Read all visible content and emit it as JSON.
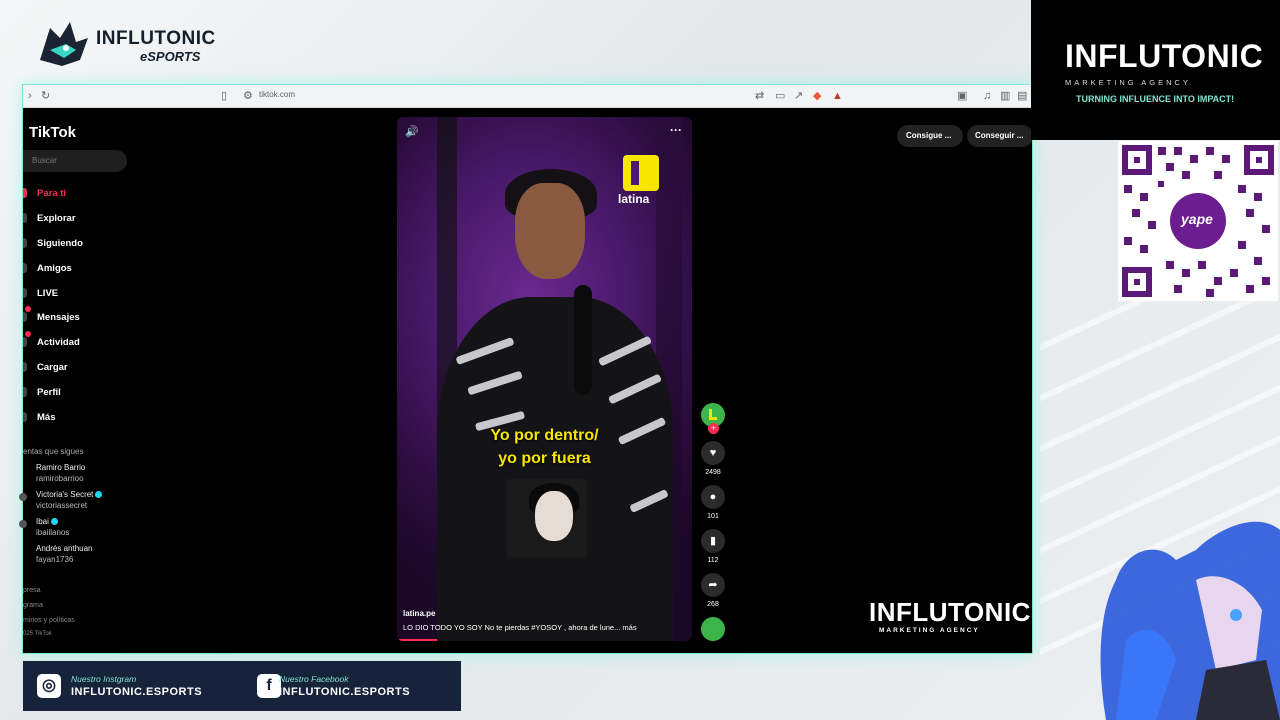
{
  "brand": {
    "esports_line1": "INFLUTONIC",
    "esports_line2": "eSPORTS"
  },
  "browser": {
    "url": "tiktok.com"
  },
  "tiktok": {
    "logo": "TikTok",
    "search_placeholder": "Buscar",
    "nav": [
      {
        "label": "Para ti",
        "active": true
      },
      {
        "label": "Explorar"
      },
      {
        "label": "Siguiendo"
      },
      {
        "label": "Amigos"
      },
      {
        "label": "LIVE"
      },
      {
        "label": "Mensajes"
      },
      {
        "label": "Actividad"
      },
      {
        "label": "Cargar"
      },
      {
        "label": "Perfil"
      },
      {
        "label": "Más"
      }
    ],
    "following_header": "entas que sigues",
    "following": [
      {
        "name": "Ramiro  Barrio",
        "user": "ramirobarrioo"
      },
      {
        "name": "Victoria's Secret",
        "user": "victoriassecret"
      },
      {
        "name": "Ibai",
        "user": "ibaillanos"
      },
      {
        "name": "Andrés anthuan",
        "user": "fayan1736"
      }
    ],
    "footer": [
      "presa",
      "grama",
      "minos y políticas",
      "025 TikTok"
    ],
    "top_buttons": [
      "Consigue ...",
      "Conseguir ..."
    ],
    "video": {
      "channel_logo_text": "latina",
      "caption_line1": "Yo por dentro/",
      "caption_line2": "yo por fuera",
      "author": "latina.pe",
      "description": "LO DIO TODO YO SOY  No te pierdas #YOSOY , ahora de lune...  más",
      "likes": "2498",
      "comments": "101",
      "saves": "112",
      "shares": "268"
    }
  },
  "watermark": {
    "title": "INFLUTONIC",
    "subtitle": "MARKETING AGENCY"
  },
  "agency": {
    "title": "INFLUTONIC",
    "subtitle": "MARKETING AGENCY",
    "tagline": "TURNING INFLUENCE INTO IMPACT!"
  },
  "qr": {
    "label": "yape"
  },
  "social": {
    "instagram_label": "Nuestro Instgram",
    "instagram_handle": "INFLUTONIC.ESPORTS",
    "facebook_label": "Nuestro Facebook",
    "facebook_handle": "INFLUTONIC.ESPORTS"
  },
  "colors": {
    "accent": "#7fe6d3",
    "tiktok_red": "#fe2c55",
    "latina_yellow": "#f6e600",
    "panel_navy": "#17233b"
  }
}
